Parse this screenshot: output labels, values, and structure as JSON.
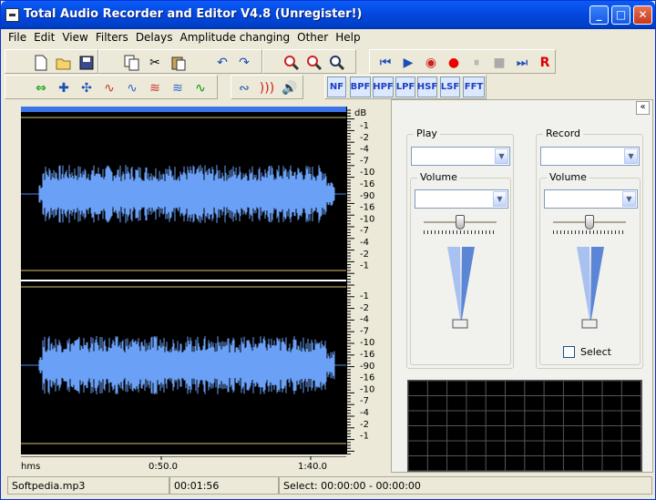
{
  "window": {
    "title": "Total Audio Recorder and Editor V4.8 (Unregister!)"
  },
  "menu": [
    "File",
    "Edit",
    "View",
    "Filters",
    "Delays",
    "Amplitude changing",
    "Other",
    "Help"
  ],
  "filters": [
    "NF",
    "BPF",
    "HPF",
    "LPF",
    "HSF",
    "LSF",
    "FFT"
  ],
  "ruler_unit": "dB",
  "ruler_labels": [
    "-1",
    "-2",
    "-4",
    "-7",
    "-10",
    "-16",
    "-90",
    "-16",
    "-10",
    "-7",
    "-4",
    "-2",
    "-1"
  ],
  "time_axis": {
    "unit": "hms",
    "ticks": [
      "0:50.0",
      "1:40.0"
    ]
  },
  "panel": {
    "collapse": "«",
    "play": {
      "label": "Play",
      "device": "",
      "volume_label": "Volume",
      "volume_value": ""
    },
    "record": {
      "label": "Record",
      "device": "",
      "volume_label": "Volume",
      "volume_value": "",
      "select_label": "Select",
      "select_checked": false
    }
  },
  "status": {
    "file": "Softpedia.mp3",
    "duration": "00:01:56",
    "selection": "Select: 00:00:00 - 00:00:00"
  }
}
